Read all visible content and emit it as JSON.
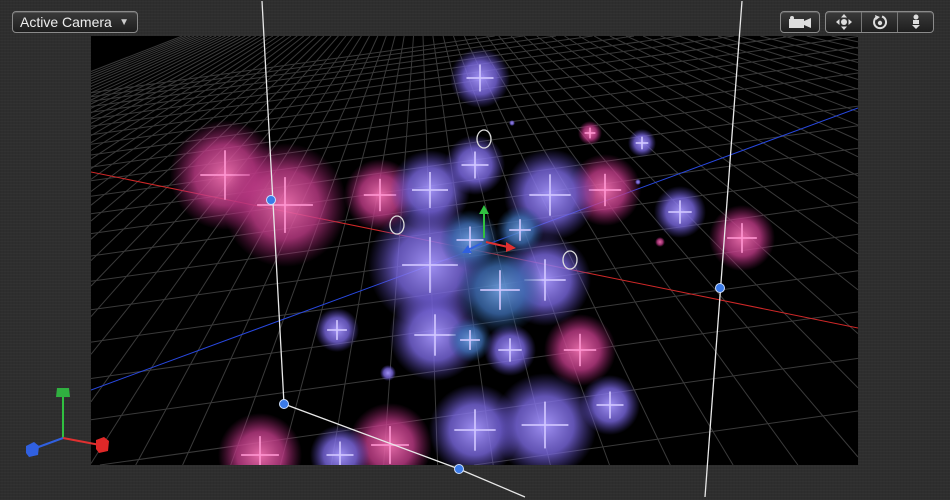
{
  "toolbar": {
    "camera_menu": {
      "label": "Active Camera",
      "icon": "chevron-down-icon"
    },
    "view_button": {
      "icon": "video-camera-icon"
    },
    "nav_tools": [
      {
        "name": "pan",
        "icon": "move-arrows-icon"
      },
      {
        "name": "orbit",
        "icon": "orbit-icon"
      },
      {
        "name": "dolly",
        "icon": "dolly-icon"
      }
    ]
  },
  "colors": {
    "x_axis": "#e03030",
    "y_axis": "#30c040",
    "z_axis": "#3060e0",
    "particle_pink": "#e0509a",
    "particle_purple": "#8a78f0",
    "particle_blue": "#5a86d0",
    "canvas_bg": "#000000"
  }
}
